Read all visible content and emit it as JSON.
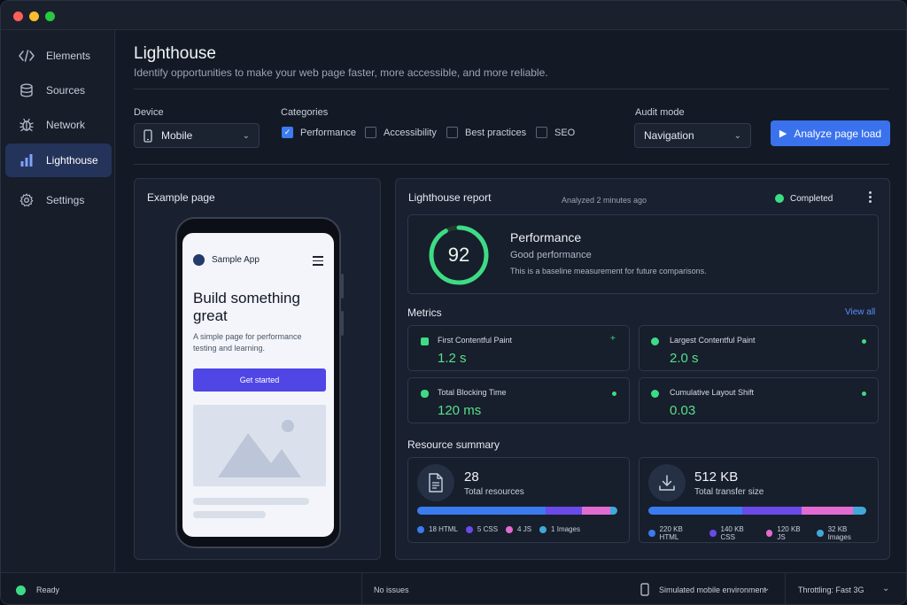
{
  "sidebar": {
    "items": [
      {
        "label": "Elements",
        "icon": "code-icon"
      },
      {
        "label": "Sources",
        "icon": "database-icon"
      },
      {
        "label": "Network",
        "icon": "bug-icon"
      },
      {
        "label": "Lighthouse",
        "icon": "bar-chart-icon",
        "active": true
      },
      {
        "label": "Settings",
        "icon": "gear-icon"
      }
    ]
  },
  "header": {
    "title": "Lighthouse",
    "subtitle": "Identify opportunities to make your web page faster, more accessible, and more reliable."
  },
  "controls": {
    "device_label": "Device",
    "device_value": "Mobile",
    "categories_label": "Categories",
    "categories": [
      {
        "label": "Performance",
        "checked": true
      },
      {
        "label": "Accessibility",
        "checked": false
      },
      {
        "label": "Best practices",
        "checked": false
      },
      {
        "label": "SEO",
        "checked": false
      }
    ],
    "audit_mode_label": "Audit mode",
    "audit_mode_value": "Navigation",
    "analyze_label": "Analyze page load"
  },
  "example": {
    "title": "Example page",
    "app_name": "Sample App",
    "hero": "Build something great",
    "hero_sub": "A simple page for performance testing and learning.",
    "cta": "Get started"
  },
  "report": {
    "title": "Lighthouse report",
    "analyzed": "Analyzed 2 minutes ago",
    "status": "Completed",
    "score": "92",
    "score_fraction": 0.92,
    "perf_title": "Performance",
    "perf_sub": "Good performance",
    "perf_desc": "This is a baseline measurement for future comparisons.",
    "metrics_label": "Metrics",
    "view_all": "View all",
    "metrics": [
      {
        "name": "First Contentful Paint",
        "value": "1.2 s"
      },
      {
        "name": "Largest Contentful Paint",
        "value": "2.0 s"
      },
      {
        "name": "Total Blocking Time",
        "value": "120 ms"
      },
      {
        "name": "Cumulative Layout Shift",
        "value": "0.03"
      }
    ],
    "resource_label": "Resource summary",
    "resources": {
      "count": "28",
      "count_label": "Total resources",
      "size": "512 KB",
      "size_label": "Total transfer size",
      "count_legend": [
        "18 HTML",
        "5 CSS",
        "4 JS",
        "1 Images"
      ],
      "size_legend": [
        "220 KB HTML",
        "140 KB CSS",
        "120 KB JS",
        "32 KB Images"
      ]
    }
  },
  "statusbar": {
    "ready": "Ready",
    "issues": "No issues",
    "environment": "Simulated mobile environment",
    "throttling": "Throttling: Fast 3G"
  },
  "colors": {
    "accent": "#3a72ee",
    "good": "#3ddc84",
    "html": "#3a7bf0",
    "css": "#6a4ae8",
    "js": "#e26bd2",
    "images": "#41a8d8"
  }
}
